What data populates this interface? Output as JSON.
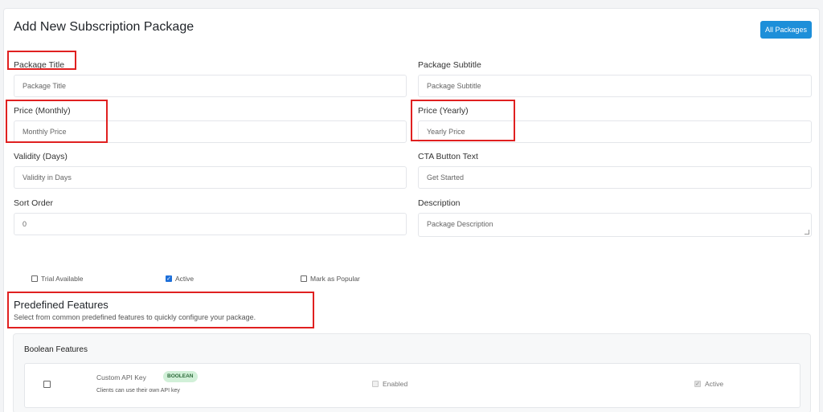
{
  "header": {
    "title": "Add New Subscription Package",
    "all_packages_label": "All Packages"
  },
  "form": {
    "package_title": {
      "label": "Package Title",
      "placeholder": "Package Title"
    },
    "package_subtitle": {
      "label": "Package Subtitle",
      "placeholder": "Package Subtitle"
    },
    "price_monthly": {
      "label": "Price (Monthly)",
      "placeholder": "Monthly Price"
    },
    "price_yearly": {
      "label": "Price (Yearly)",
      "placeholder": "Yearly Price"
    },
    "validity": {
      "label": "Validity (Days)",
      "placeholder": "Validity in Days"
    },
    "cta_text": {
      "label": "CTA Button Text",
      "value": "Get Started"
    },
    "sort_order": {
      "label": "Sort Order",
      "value": "0"
    },
    "description": {
      "label": "Description",
      "placeholder": "Package Description"
    }
  },
  "options": {
    "trial_available": {
      "label": "Trial Available",
      "checked": false
    },
    "active": {
      "label": "Active",
      "checked": true
    },
    "mark_popular": {
      "label": "Mark as Popular",
      "checked": false
    }
  },
  "predefined": {
    "title": "Predefined Features",
    "subtitle": "Select from common predefined features to quickly configure your package.",
    "boolean_section_title": "Boolean Features",
    "features": [
      {
        "name": "Custom API Key",
        "badge": "BOOLEAN",
        "description": "Clients can use their own API key",
        "enabled_label": "Enabled",
        "active_label": "Active"
      }
    ]
  },
  "colors": {
    "accent": "#1d8fd9",
    "highlight": "#e02020",
    "badge_bg": "#d1f0d8"
  }
}
